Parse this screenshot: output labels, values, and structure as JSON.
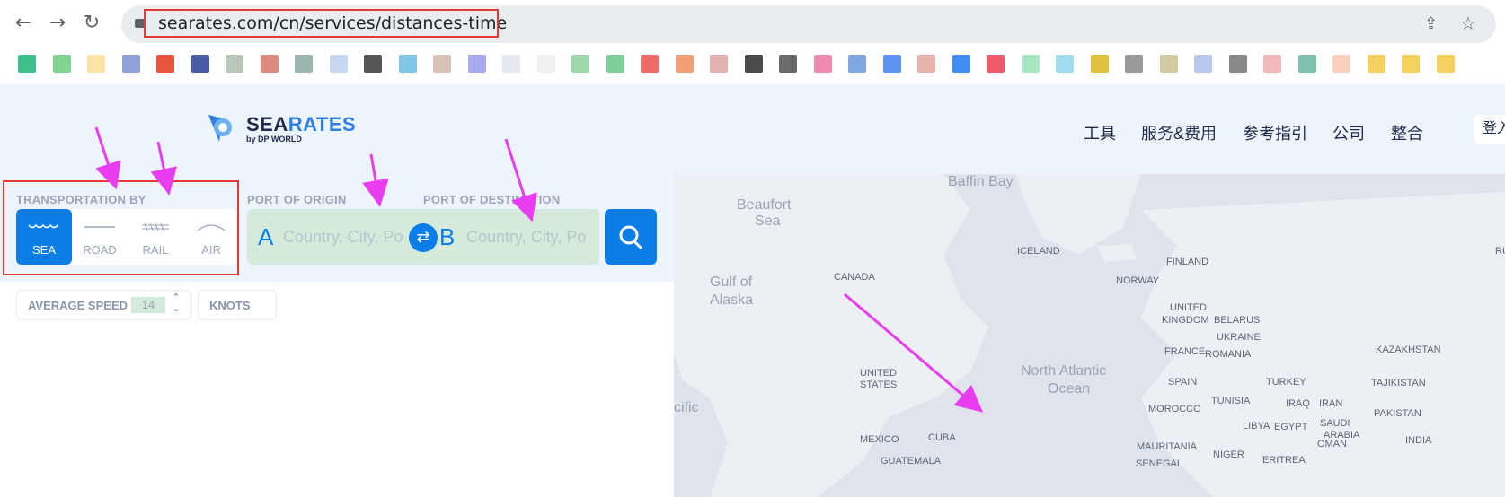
{
  "browser": {
    "url": "searates.com/cn/services/distances-time",
    "back_icon": "arrow-left-icon",
    "forward_icon": "arrow-right-icon",
    "reload_icon": "reload-icon"
  },
  "bookmarks_colors": [
    "#3fbf8a",
    "#7fd58f",
    "#fbe3a2",
    "#8da0d8",
    "#e8553f",
    "#4a5ca8",
    "#b8c7b8",
    "#e08b80",
    "#9bb5b0",
    "#c8d8f0",
    "#555555",
    "#7fc6e8",
    "#d9c2b8",
    "#a9a9f0",
    "#e6eaf0",
    "#eef0f2",
    "#9fd8a8",
    "#7fd098",
    "#ef6a6a",
    "#f2a07a",
    "#e0b2b2",
    "#4a4a4a",
    "#6a6a6a",
    "#ef8ab0",
    "#7fa6e0",
    "#5d92f0",
    "#e9b2a8",
    "#3f8ef0",
    "#ef5a6a",
    "#a8e6c2",
    "#a0ddf0",
    "#e0c040",
    "#999999",
    "#d2caa0",
    "#b8c8f0",
    "#888888",
    "#f5b8b8",
    "#80c0b0",
    "#fbd0c0",
    "#f5d060",
    "#f5d060",
    "#f5d060"
  ],
  "header": {
    "logo": {
      "main_dark": "SEA",
      "main_accent": "RATES",
      "sub": "by DP WORLD"
    },
    "nav": [
      "工具",
      "服务&费用",
      "参考指引",
      "公司",
      "整合"
    ],
    "login": "登入"
  },
  "search": {
    "transport_label": "TRANSPORTATION BY",
    "modes": [
      {
        "label": "SEA",
        "icon": "waves-icon",
        "selected": true
      },
      {
        "label": "ROAD",
        "icon": "road-icon",
        "selected": false
      },
      {
        "label": "RAIL",
        "icon": "rail-icon",
        "selected": false
      },
      {
        "label": "AIR",
        "icon": "air-icon",
        "selected": false
      }
    ],
    "origin_label": "PORT OF ORIGIN",
    "origin_letter": "A",
    "origin_placeholder": "Country, City, Po",
    "destination_label": "PORT OF DESTINATION",
    "destination_letter": "B",
    "destination_placeholder": "Country, City, Po",
    "swap_icon": "swap-icon",
    "search_icon": "search-icon",
    "avg_speed_label": "AVERAGE SPEED",
    "avg_speed_value": "14",
    "unit_label": "KNOTS"
  },
  "map": {
    "labels": [
      "Baffin Bay",
      "Beaufort",
      "Sea",
      "Gulf of",
      "Alaska",
      "ICELAND",
      "FINLAND",
      "NORWAY",
      "CANADA",
      "UNITED",
      "KINGDOM",
      "BELARUS",
      "UKRAINE",
      "FRANCE",
      "ROMANIA",
      "KAZAKHSTAN",
      "North Atlantic",
      "Ocean",
      "UNITED",
      "STATES",
      "SPAIN",
      "TURKEY",
      "TAJIKISTAN",
      "cific",
      "MOROCCO",
      "TUNISIA",
      "IRAQ",
      "IRAN",
      "PAKISTAN",
      "LIBYA",
      "EGYPT",
      "SAUDI",
      "ARABIA",
      "MEXICO",
      "CUBA",
      "MAURITANIA",
      "NIGER",
      "OMAN",
      "INDIA",
      "GUATEMALA",
      "SENEGAL",
      "ERITREA",
      "RU"
    ]
  },
  "annotations": {
    "highlight_color": "#e53935",
    "arrow_color": "#e83ef0"
  }
}
